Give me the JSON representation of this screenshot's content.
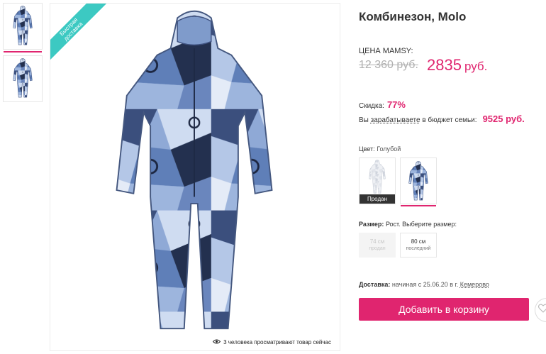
{
  "product": {
    "title": "Комбинезон, Molo",
    "price_label": "ЦЕНА MAMSY:",
    "old_price": "12 360 руб.",
    "new_price": "2835",
    "currency": "руб.",
    "discount_label": "Скидка:",
    "discount_value": "77%",
    "earn_prefix": "Вы",
    "earn_link": "зарабатываете",
    "earn_suffix": "в бюджет семьи:",
    "earn_value": "9525 руб."
  },
  "ribbon": {
    "line1": "Быстрая",
    "line2": "доставка"
  },
  "viewers_text": "3 человека просматривают товар сейчас",
  "color": {
    "label": "Цвет:",
    "value": "Голубой",
    "swatches": [
      {
        "name": "white",
        "sold_label": "Продан",
        "selected": false
      },
      {
        "name": "blue",
        "selected": true
      }
    ]
  },
  "size": {
    "label": "Размер:",
    "hint": "Рост. Выберите размер:",
    "options": [
      {
        "size": "74 см",
        "status": "продан",
        "available": false
      },
      {
        "size": "80 см",
        "status": "последний",
        "available": true
      }
    ]
  },
  "delivery": {
    "label": "Доставка:",
    "text": "начиная с 25.06.20 в г.",
    "city": "Кемерово"
  },
  "add_to_cart": "Добавить в корзину",
  "colors": {
    "accent": "#e0256f",
    "ribbon": "#3cc9c2",
    "garment_blue": "#6e8fc4",
    "garment_dark": "#2f3f63"
  },
  "icons": [
    "eye-icon",
    "heart-icon"
  ]
}
